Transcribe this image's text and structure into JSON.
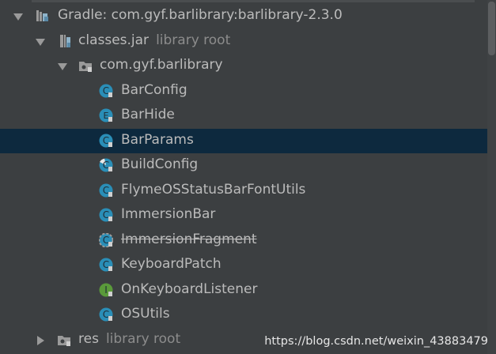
{
  "tree": {
    "gradle_label": "Gradle: com.gyf.barlibrary:barlibrary-2.3.0",
    "jar_label": "classes.jar",
    "jar_hint": "library root",
    "package_label": "com.gyf.barlibrary",
    "classes": [
      {
        "name": "BarConfig",
        "kind": "C"
      },
      {
        "name": "BarHide",
        "kind": "E"
      },
      {
        "name": "BarParams",
        "kind": "C"
      },
      {
        "name": "BuildConfig",
        "kind": "C"
      },
      {
        "name": "FlymeOSStatusBarFontUtils",
        "kind": "C"
      },
      {
        "name": "ImmersionBar",
        "kind": "C"
      },
      {
        "name": "ImmersionFragment",
        "kind": "C"
      },
      {
        "name": "KeyboardPatch",
        "kind": "C"
      },
      {
        "name": "OnKeyboardListener",
        "kind": "I"
      },
      {
        "name": "OSUtils",
        "kind": "C"
      }
    ],
    "res_label": "res",
    "res_hint": "library root"
  },
  "selected_class": "BarParams",
  "deprecated_class": "ImmersionFragment",
  "watermark": "https://blog.csdn.net/weixin_43883479",
  "colors": {
    "background": "#3c3f41",
    "selection": "#0d293e",
    "text": "#bbbbbb",
    "hint": "#8c8c8c",
    "class_icon": "#2a8eb7",
    "enum_icon": "#2a8eb7",
    "interface_icon": "#5a9a3a"
  }
}
